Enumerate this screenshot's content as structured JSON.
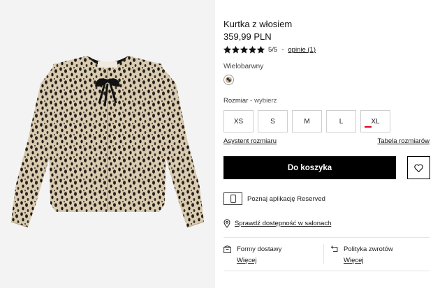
{
  "product": {
    "title": "Kurtka z włosiem",
    "price": "359,99 PLN",
    "rating": {
      "stars_filled": 5,
      "stars_total": 5,
      "score_text": "5/5",
      "separator": "-",
      "reviews_text": "opinie (1)"
    },
    "color": {
      "label": "Wielobarwny",
      "swatch_icon": "leopard-swatch-icon"
    },
    "size_section": {
      "label": "Rozmiar -",
      "hint": "wybierz",
      "sizes": [
        "XS",
        "S",
        "M",
        "L",
        "XL"
      ],
      "low_stock_size": "XL",
      "low_stock_color": "#e2001a"
    },
    "links": {
      "size_assistant": "Asystent rozmiaru",
      "size_table": "Tabela rozmiarów"
    },
    "actions": {
      "add_to_cart": "Do koszyka",
      "wishlist_icon": "heart-icon"
    }
  },
  "app_promo": {
    "text": "Poznaj aplikację Reserved",
    "icon": "phone-icon"
  },
  "store_availability": {
    "text": "Sprawdź dostępność w salonach",
    "icon": "location-pin-icon"
  },
  "info": {
    "delivery": {
      "label": "Formy dostawy",
      "more": "Więcej",
      "icon": "box-icon"
    },
    "returns": {
      "label": "Polityka zwrotów",
      "more": "Więcej",
      "icon": "return-arrow-icon"
    }
  },
  "colors": {
    "primary_button": "#000000",
    "pattern_base": "#d9cbb0",
    "pattern_spot": "#1f1a16"
  }
}
